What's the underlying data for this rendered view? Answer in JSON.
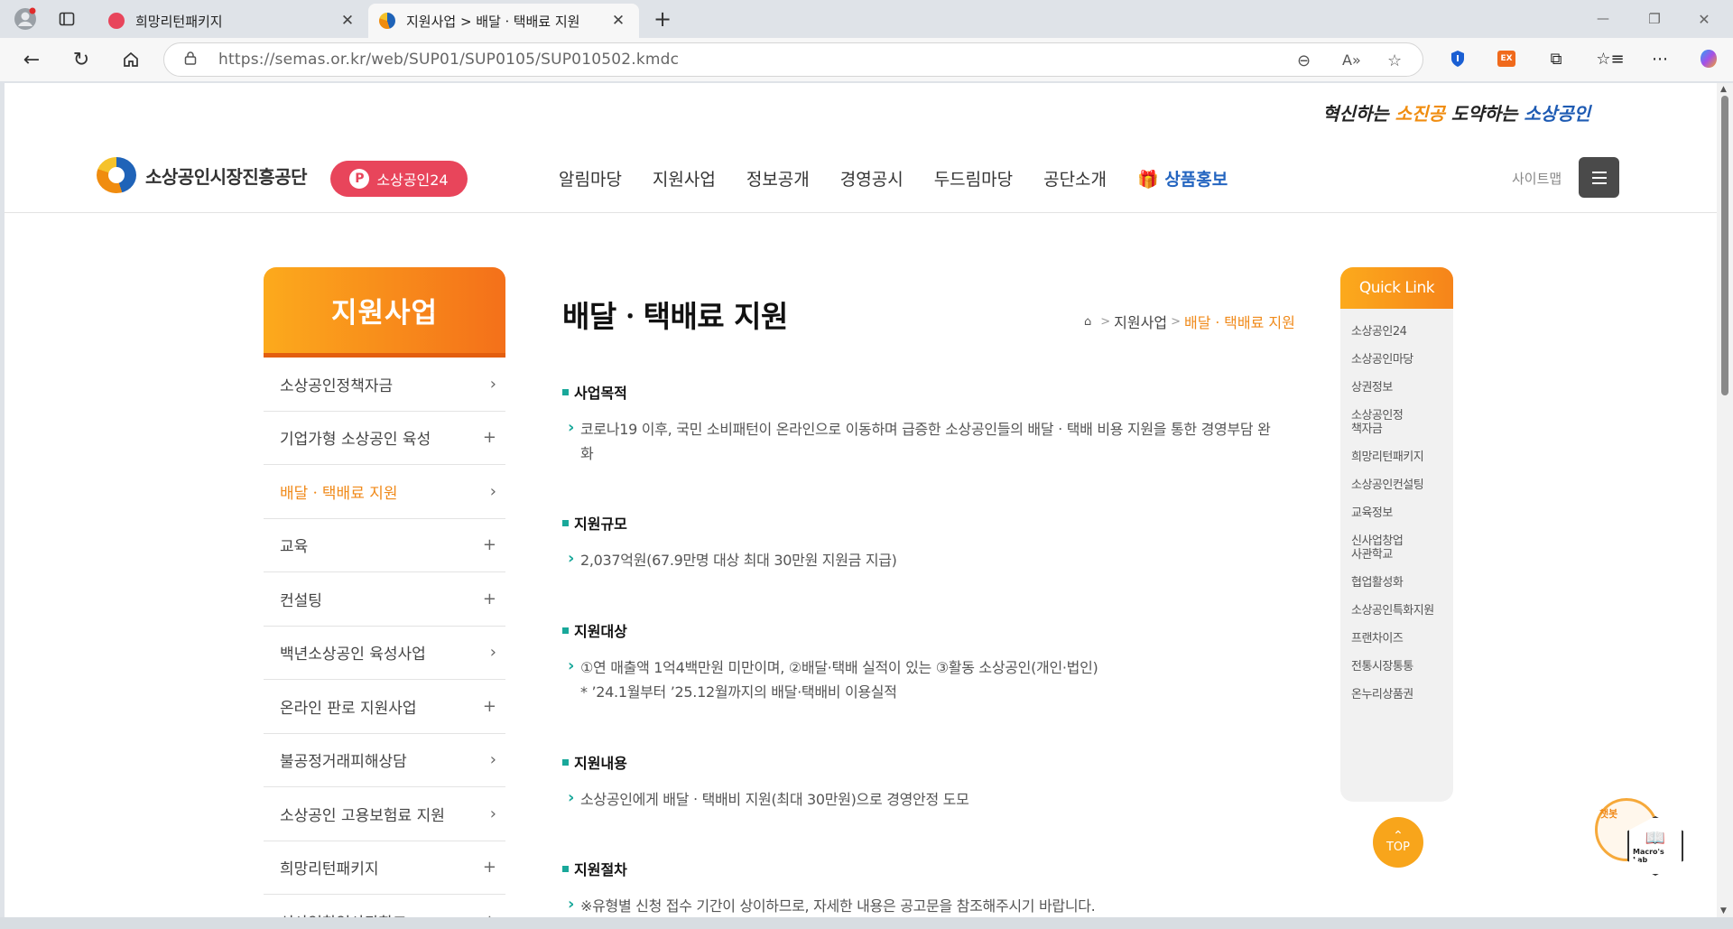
{
  "browser": {
    "tabs": [
      {
        "title": "희망리턴패키지",
        "close": "✕"
      },
      {
        "title": "지원사업 > 배달ㆍ택배료 지원",
        "close": "✕"
      }
    ],
    "new_tab": "+",
    "url_host": "https://semas.or.kr",
    "url_path": "/web/SUP01/SUP0105/SUP010502.kmdc",
    "window": {
      "minimize": "—",
      "restore": "❐",
      "close": "✕"
    }
  },
  "site": {
    "slogan_prefix": "혁신하는 ",
    "slogan_o1": "소진공",
    "slogan_mid": " 도약하는 ",
    "slogan_b1": "소상공인",
    "logo_name": "소상공인시장진흥공단",
    "sg24_label": "소상공인24",
    "menu": [
      "알림마당",
      "지원사업",
      "정보공개",
      "경영공시",
      "두드림마당",
      "공단소개"
    ],
    "promo_label": "상품홍보",
    "sitemap_label": "사이트맵"
  },
  "lnb": {
    "title": "지원사업",
    "items": [
      {
        "label": "소상공인정책자금",
        "icon": "›"
      },
      {
        "label": "기업가형 소상공인 육성",
        "icon": "+"
      },
      {
        "label": "배달ㆍ택배료 지원",
        "icon": "›"
      },
      {
        "label": "교육",
        "icon": "+"
      },
      {
        "label": "컨설팅",
        "icon": "+"
      },
      {
        "label": "백년소상공인 육성사업",
        "icon": "›"
      },
      {
        "label": "온라인 판로 지원사업",
        "icon": "+"
      },
      {
        "label": "불공정거래피해상담",
        "icon": "›"
      },
      {
        "label": "소상공인 고용보험료 지원",
        "icon": "›"
      },
      {
        "label": "희망리턴패키지",
        "icon": "+"
      },
      {
        "label": "신사업창업사관학교",
        "icon": "+"
      }
    ]
  },
  "content": {
    "title": "배달ㆍ택배료 지원",
    "breadcrumb": {
      "parent": "지원사업",
      "current": "배달ㆍ택배료 지원"
    },
    "sections": [
      {
        "heading": "사업목적",
        "text": "코로나19 이후, 국민 소비패턴이 온라인으로 이동하며 급증한 소상공인들의 배달ㆍ택배 비용 지원을 통한 경영부담 완화"
      },
      {
        "heading": "지원규모",
        "text": "2,037억원(67.9만명 대상 최대 30만원 지원금 지급)"
      },
      {
        "heading": "지원대상",
        "text": "①연 매출액 1억4백만원 미만이며, ②배달·택배 실적이 있는 ③활동 소상공인(개인·법인)",
        "note": "* ’24.1월부터 ’25.12월까지의 배달·택배비 이용실적"
      },
      {
        "heading": "지원내용",
        "text": "소상공인에게 배달ㆍ택배비 지원(최대 30만원)으로 경영안정 도모"
      },
      {
        "heading": "지원절차",
        "text": "※유형별 신청 접수 기간이 상이하므로, 자세한 내용은 공고문을 참조해주시기 바랍니다."
      }
    ]
  },
  "quicklink": {
    "title": "Quick Link",
    "items": [
      "소상공인24",
      "소상공인마당",
      "상권정보",
      "소상공인정책자금",
      "희망리턴패키지",
      "소상공인컨설팅",
      "교육정보",
      "신사업창업사관학교",
      "협업활성화",
      "소상공인특화지원",
      "프랜차이즈",
      "전통시장통통",
      "온누리상품권"
    ]
  },
  "top_label": "TOP",
  "chatbot_label": "챗봇",
  "macro_label": "Macro's Lab"
}
